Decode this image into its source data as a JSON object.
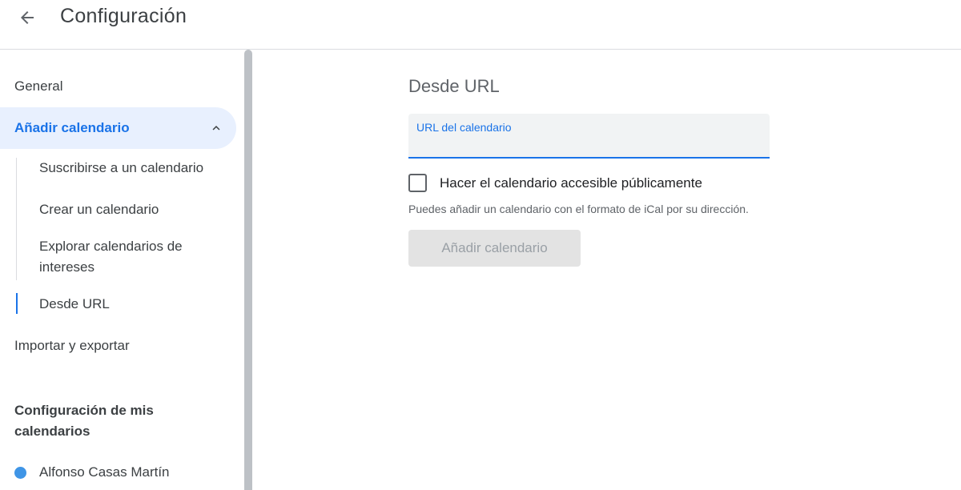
{
  "header": {
    "title": "Configuración"
  },
  "sidebar": {
    "items": [
      {
        "label": "General"
      },
      {
        "label": "Añadir calendario"
      },
      {
        "label": "Importar y exportar"
      }
    ],
    "subitems": [
      {
        "label": "Suscribirse a un calendario"
      },
      {
        "label": "Crear un calendario"
      },
      {
        "label": "Explorar calendarios de intereses"
      },
      {
        "label": "Desde URL"
      }
    ],
    "section_title": "Configuración de mis calendarios",
    "calendars": [
      {
        "name": "Alfonso Casas Martín",
        "color": "#3f95e6"
      }
    ]
  },
  "main": {
    "title": "Desde URL",
    "url_field": {
      "label": "URL del calendario",
      "value": ""
    },
    "checkbox_label": "Hacer el calendario accesible públicamente",
    "checkbox_checked": false,
    "helper": "Puedes añadir un calendario con el formato de iCal por su dirección.",
    "add_button": "Añadir calendario"
  },
  "icons": {
    "back": "arrow-left-icon",
    "expand": "chevron-up-icon"
  },
  "colors": {
    "accent": "#1a73e8",
    "active_bg": "#e8f0fe",
    "selected_bg": "#f1f3f4"
  }
}
